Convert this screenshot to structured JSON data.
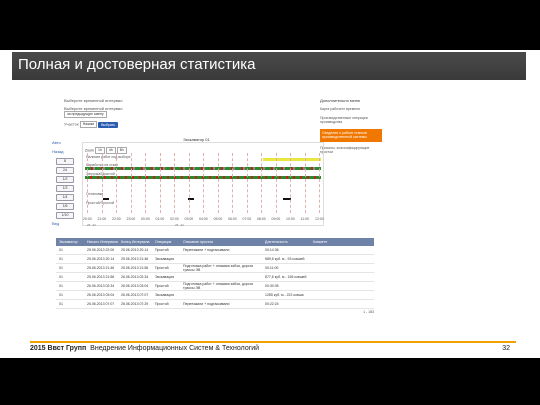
{
  "slide": {
    "title": "Полная и достоверная статистика",
    "footer_brand": "2015 Ввст Групп",
    "footer_text": "Внедрение Информационных Систем & Технологий",
    "page_number": "32",
    "accent": "#f0a000"
  },
  "form": {
    "header": "Выберите временной интервал",
    "label1": "Выберите временной интервал",
    "select1": "за предыдущую смену",
    "label2": "Участок",
    "select2": "Нажим",
    "button": "Выбрать"
  },
  "right_panel": {
    "header": "Дополнительно меню",
    "items": [
      "Карта рабочего времени",
      "Производственные операции производства",
      "Сведения о работе станков производственной системы",
      "Причины, классифицирующие простои"
    ]
  },
  "nav": {
    "link1": "Авто",
    "link2": "Назад",
    "zoom_buttons": [
      "8",
      "24",
      "1/2",
      "1/3",
      "1/4",
      "1/6",
      "1/10"
    ],
    "link3": "Вед"
  },
  "chart": {
    "title": "Экскаватор 01",
    "zoom_label": "Zoom",
    "zoom_options": [
      "1h",
      "4h",
      "8h"
    ],
    "row_labels": [
      "Наличие работ под выборе",
      "Наработка на отказ",
      "Загрузка/Простой",
      "Остановки",
      "Простой/Простой"
    ],
    "ticks": [
      "20:00",
      "21:00",
      "22:00",
      "23:00",
      "00:00",
      "01:00",
      "02:00",
      "03:00",
      "04:00",
      "05:00",
      "06:00",
      "07:00",
      "08:00",
      "09:00",
      "10:00",
      "11:00",
      "12:00"
    ],
    "dates": [
      "25. Jul",
      "26. Jul"
    ]
  },
  "table": {
    "headers": [
      "Экскаватор",
      "Начало Интервала",
      "Конец Интервала",
      "Операция",
      "Описание простоя",
      "Длительность",
      "Коммент"
    ],
    "rows": [
      [
        "01",
        "25.06.2013 22:00",
        "25.06.2013 20:14",
        "Простой",
        "Переезжали + подтаскивали",
        "00:14:36",
        ""
      ],
      [
        "01",
        "25.06.2013 20:14",
        "25.06.2013 21:46",
        "Экскавация",
        "",
        "589,6 куб. м - 93 ковшей",
        ""
      ],
      [
        "01",
        "25.06.2013 21:46",
        "25.06.2013 21:56",
        "Простой",
        "Подготовка работ + отмывка забоя, дорога трассы ЭВ",
        "00:11:00",
        ""
      ],
      [
        "01",
        "25.06.2013 21:56",
        "26.06.2013 02:34",
        "Экскавация",
        "",
        "877,6 куб. м - 156 ковшей",
        ""
      ],
      [
        "01",
        "26.06.2013 02:34",
        "26.06.2013 03:04",
        "Простой",
        "Подготовка работ + отмывка забоя, дорога трассы ЭВ",
        "00:30:35",
        ""
      ],
      [
        "01",
        "26.06.2013 03:04",
        "26.06.2013 07:07",
        "Экскавация",
        "",
        "1285 куб. м - 222 ковша",
        ""
      ],
      [
        "01",
        "26.06.2013 07:07",
        "26.06.2013 07:29",
        "Простой",
        "Переезжали + подтаскивали",
        "00:22:24",
        ""
      ]
    ],
    "pager": "1 - 183"
  }
}
